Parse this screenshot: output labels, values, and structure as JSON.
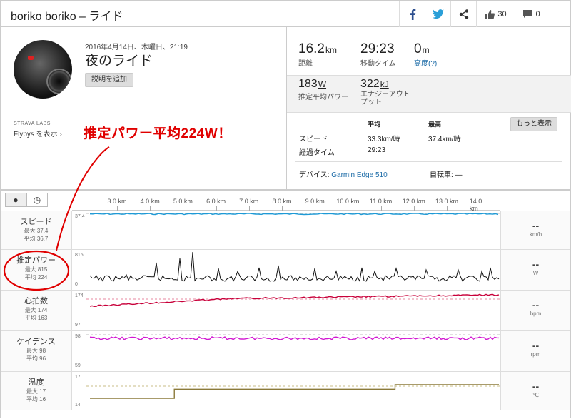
{
  "header": {
    "title": "boriko boriko – ライド",
    "kudos_count": "30",
    "comment_count": "0"
  },
  "activity": {
    "date": "2016年4月14日、木曜日、21:19",
    "name": "夜のライド",
    "add_description": "説明を追加",
    "labs": "STRAVA LABS",
    "flyby": "Flybys を表示"
  },
  "annotation": "推定パワー平均224W！",
  "stats": {
    "distance": {
      "value": "16.2",
      "unit": "km",
      "label": "距離"
    },
    "moving_time": {
      "value": "29:23",
      "label": "移動タイム"
    },
    "elevation": {
      "value": "0",
      "unit": "m",
      "label": "高度(?)"
    },
    "power": {
      "value": "183",
      "unit": "W",
      "label": "推定平均パワー"
    },
    "energy": {
      "value": "322",
      "unit": "kJ",
      "label": "エナジーアウト プット"
    }
  },
  "table": {
    "col_avg": "平均",
    "col_max": "最高",
    "row_speed": "スピード",
    "speed_avg": "33.3km/時",
    "speed_max": "37.4km/時",
    "row_elapsed": "経過タイム",
    "elapsed_avg": "29:23",
    "more": "もっと表示"
  },
  "device": {
    "label": "デバイス:",
    "name": "Garmin Edge 510",
    "bike_label": "自転車: —"
  },
  "chart_data": {
    "type": "line",
    "x_ticks": [
      "3.0 km",
      "4.0 km",
      "5.0 km",
      "6.0 km",
      "7.0 km",
      "8.0 km",
      "9.0 km",
      "10.0 km",
      "11.0 km",
      "12.0 km",
      "13.0 km",
      "14.0 km"
    ],
    "series": [
      {
        "name": "スピード",
        "max_label": "最大 37.4",
        "avg_label": "平均 36.7",
        "axis_max": "37.4",
        "unit": "km/h",
        "current": "--",
        "color": "#1e9ad6"
      },
      {
        "name": "推定パワー",
        "max_label": "最大 815",
        "avg_label": "平均 224",
        "axis_max": "815",
        "axis_min": "0",
        "unit": "W",
        "current": "--",
        "color": "#111111"
      },
      {
        "name": "心拍数",
        "max_label": "最大 174",
        "avg_label": "平均 163",
        "axis_max": "174",
        "axis_min": "97",
        "unit": "bpm",
        "current": "--",
        "color": "#c8003a"
      },
      {
        "name": "ケイデンス",
        "max_label": "最大 98",
        "avg_label": "平均 96",
        "axis_max": "98",
        "axis_min": "59",
        "unit": "rpm",
        "current": "--",
        "color": "#d21ad2"
      },
      {
        "name": "温度",
        "max_label": "最大 17",
        "avg_label": "平均 16",
        "axis_max": "17",
        "axis_min": "14",
        "unit": "℃",
        "current": "--",
        "color": "#8b7a3a",
        "steps": [
          {
            "from_km": 2.0,
            "value": 14
          },
          {
            "from_km": 4.6,
            "value": 16
          },
          {
            "from_km": 11.4,
            "value": 17
          }
        ]
      }
    ]
  }
}
